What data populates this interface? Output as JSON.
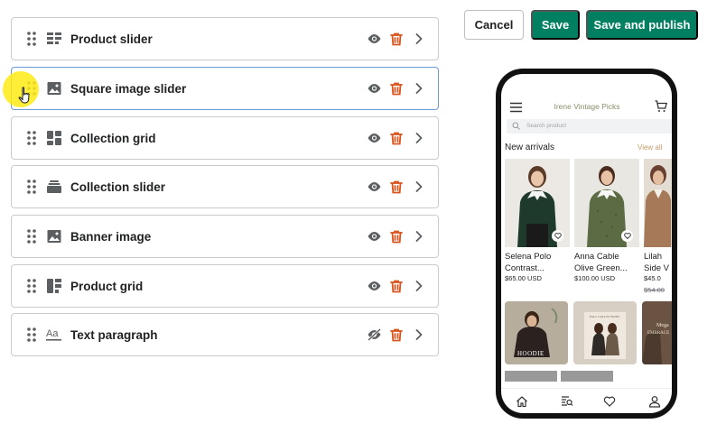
{
  "toolbar": {
    "cancel_label": "Cancel",
    "save_label": "Save",
    "publish_label": "Save and publish"
  },
  "blocks": [
    {
      "label": "Product slider",
      "icon": "product-slider-icon",
      "visible": true
    },
    {
      "label": "Square image slider",
      "icon": "image-slider-icon",
      "visible": true,
      "selected": true
    },
    {
      "label": "Collection grid",
      "icon": "collection-grid-icon",
      "visible": true
    },
    {
      "label": "Collection slider",
      "icon": "collection-slider-icon",
      "visible": true
    },
    {
      "label": "Banner image",
      "icon": "banner-image-icon",
      "visible": true
    },
    {
      "label": "Product grid",
      "icon": "product-grid-icon",
      "visible": true
    },
    {
      "label": "Text paragraph",
      "icon": "text-paragraph-icon",
      "visible": false
    }
  ],
  "preview": {
    "store_name": "Irene Vintage Picks",
    "search_placeholder": "Search product",
    "section_title": "New arrivals",
    "view_all": "View all",
    "products": [
      {
        "name_line1": "Selena Polo",
        "name_line2": "Contrast...",
        "price": "$65.00 USD"
      },
      {
        "name_line1": "Anna Cable",
        "name_line2": "Olive Green...",
        "price": "$100.00 USD"
      },
      {
        "name_line1": "Lilah",
        "name_line2": "Side V",
        "price": "$45.0",
        "old_price": "$54.00"
      }
    ],
    "banners": [
      {
        "text": "HOODIE"
      },
      {
        "text": "FALL COLLECTIONS"
      },
      {
        "text": "Mega",
        "text2": "EMBRACE"
      }
    ]
  },
  "colors": {
    "primary": "#008060",
    "delete": "#d8551f",
    "selected_border": "#6f9ad8",
    "cursor_highlight": "#ffeb14"
  }
}
